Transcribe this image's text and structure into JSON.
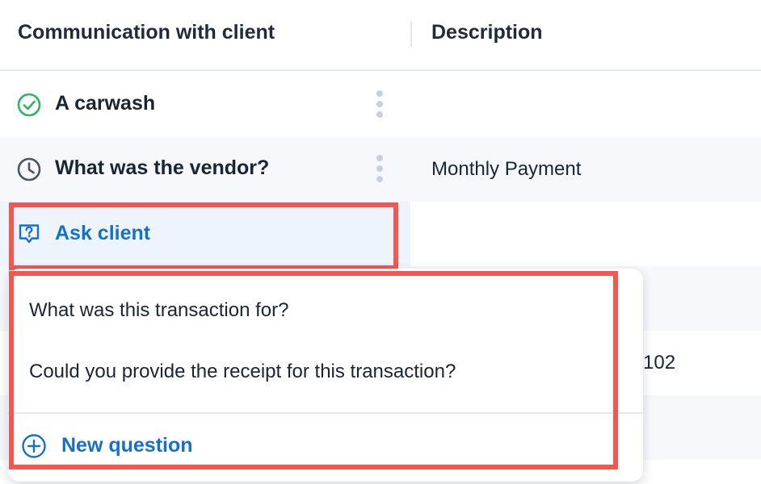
{
  "table": {
    "columns": {
      "communication": "Communication with client",
      "description": "Description"
    },
    "rows": [
      {
        "label": "A carwash",
        "status_icon": "check-circle-icon",
        "description": ""
      },
      {
        "label": "What was the vendor?",
        "status_icon": "clock-icon",
        "description": "Monthly Payment"
      },
      {
        "label": "Ask client",
        "status_icon": "question-chat-icon",
        "description": ""
      },
      {
        "label": "",
        "description": ""
      },
      {
        "label": "",
        "description": "102"
      }
    ]
  },
  "dropdown": {
    "options": [
      "What was this transaction for?",
      "Could you provide the receipt for this transaction?"
    ],
    "new_question_label": "New question",
    "new_question_icon": "plus-circle-icon"
  },
  "colors": {
    "accent": "#1570c7",
    "success": "#2ab463",
    "pending": "#4a5562",
    "highlight": "#f5564f",
    "row_alt": "#f6f8fc",
    "selected_cell": "#eef4fc"
  }
}
